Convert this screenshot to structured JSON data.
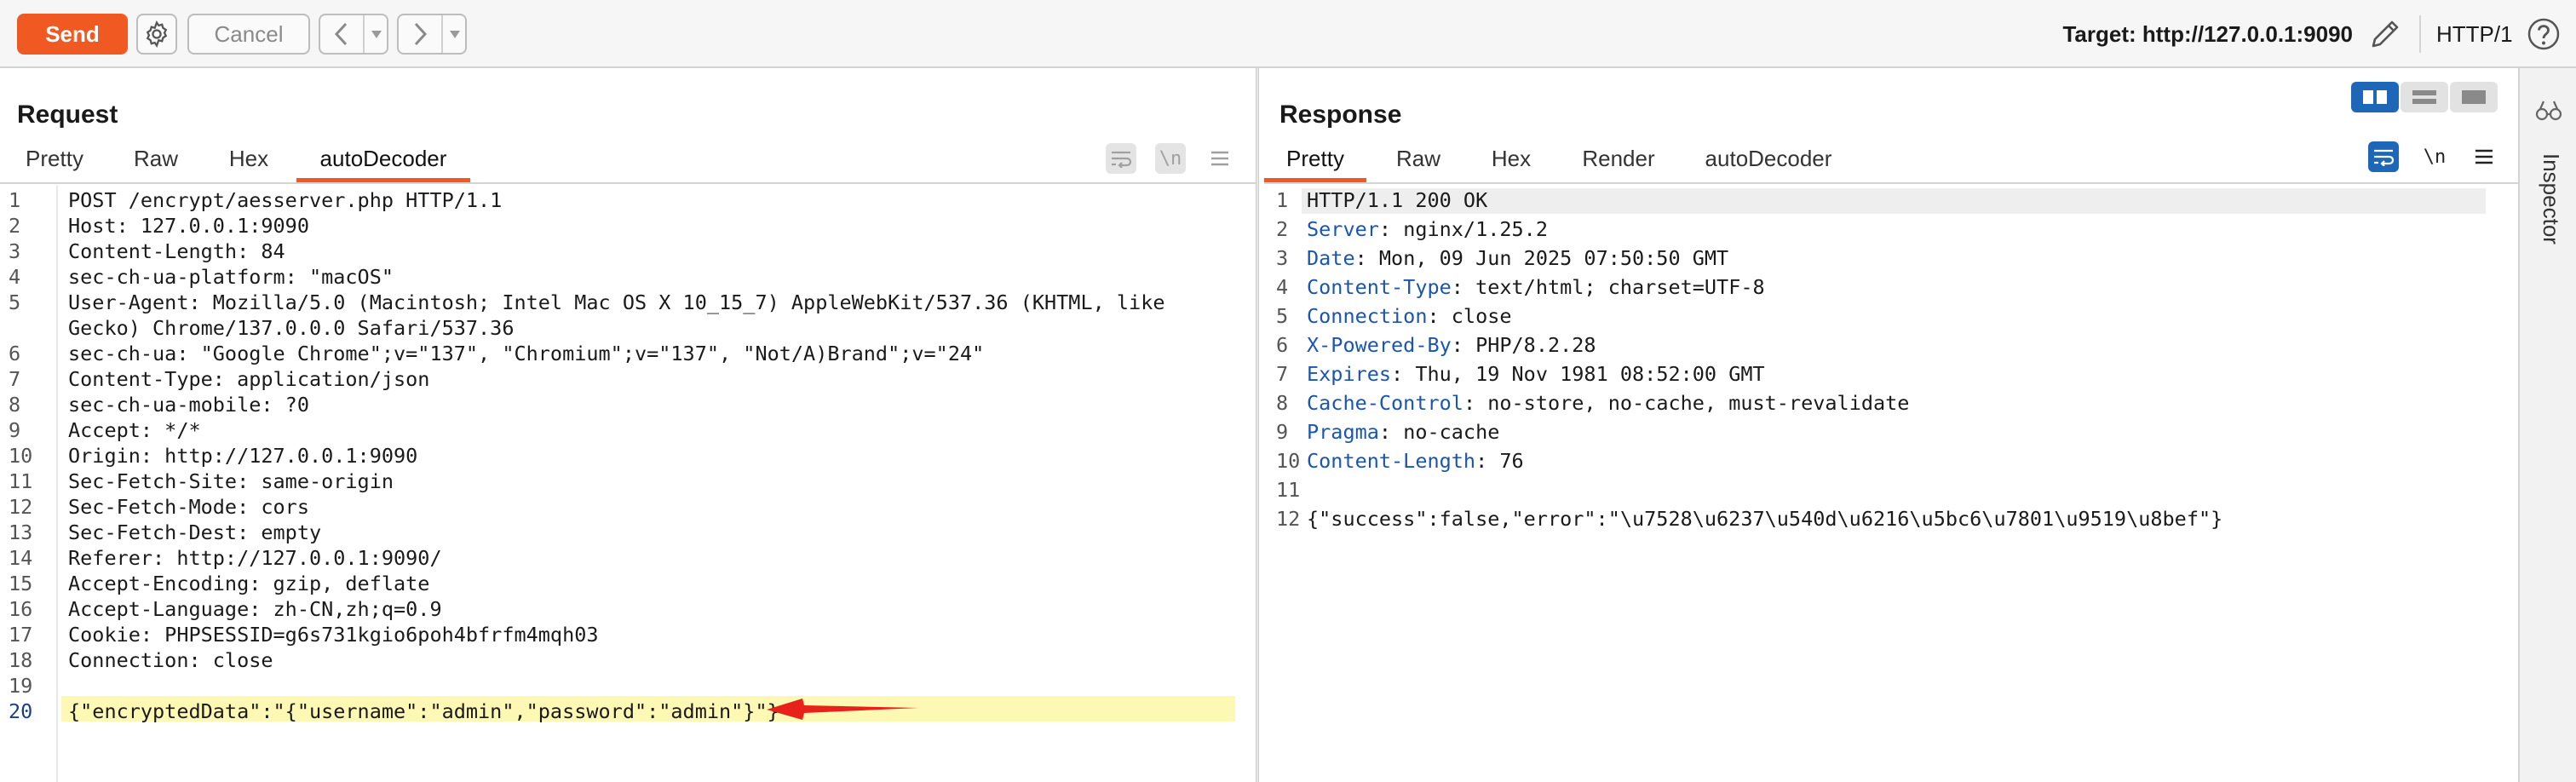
{
  "toolbar": {
    "send_label": "Send",
    "cancel_label": "Cancel",
    "target_label": "Target: http://127.0.0.1:9090",
    "protocol_label": "HTTP/1",
    "accent_color": "#f05a22",
    "icons": [
      "gear-icon",
      "back-arrow-icon",
      "forward-arrow-icon",
      "pencil-icon",
      "help-icon"
    ]
  },
  "request": {
    "title": "Request",
    "tabs": [
      "Pretty",
      "Raw",
      "Hex",
      "autoDecoder"
    ],
    "active_tab": "autoDecoder",
    "wrap_symbol": "\\n",
    "lines": [
      {
        "num": "1",
        "text": "POST /encrypt/aesserver.php HTTP/1.1"
      },
      {
        "num": "2",
        "text": "Host: 127.0.0.1:9090"
      },
      {
        "num": "3",
        "text": "Content-Length: 84"
      },
      {
        "num": "4",
        "text": "sec-ch-ua-platform: \"macOS\""
      },
      {
        "num": "5",
        "text": "User-Agent: Mozilla/5.0 (Macintosh; Intel Mac OS X 10_15_7) AppleWebKit/537.36 (KHTML, like",
        "cont": "Gecko) Chrome/137.0.0.0 Safari/537.36"
      },
      {
        "num": "6",
        "text": "sec-ch-ua: \"Google Chrome\";v=\"137\", \"Chromium\";v=\"137\", \"Not/A)Brand\";v=\"24\""
      },
      {
        "num": "7",
        "text": "Content-Type: application/json"
      },
      {
        "num": "8",
        "text": "sec-ch-ua-mobile: ?0"
      },
      {
        "num": "9",
        "text": "Accept: */*"
      },
      {
        "num": "10",
        "text": "Origin: http://127.0.0.1:9090"
      },
      {
        "num": "11",
        "text": "Sec-Fetch-Site: same-origin"
      },
      {
        "num": "12",
        "text": "Sec-Fetch-Mode: cors"
      },
      {
        "num": "13",
        "text": "Sec-Fetch-Dest: empty"
      },
      {
        "num": "14",
        "text": "Referer: http://127.0.0.1:9090/"
      },
      {
        "num": "15",
        "text": "Accept-Encoding: gzip, deflate"
      },
      {
        "num": "16",
        "text": "Accept-Language: zh-CN,zh;q=0.9"
      },
      {
        "num": "17",
        "text": "Cookie: PHPSESSID=g6s731kgio6poh4bfrfm4mqh03"
      },
      {
        "num": "18",
        "text": "Connection: close"
      },
      {
        "num": "19",
        "text": ""
      },
      {
        "num": "20",
        "text": "{\"encryptedData\":\"{\"username\":\"admin\",\"password\":\"admin\"}\"}",
        "highlight": true
      }
    ],
    "highlight_color": "#fdf8b4",
    "arrow_color": "#e8211b"
  },
  "response": {
    "title": "Response",
    "tabs": [
      "Pretty",
      "Raw",
      "Hex",
      "Render",
      "autoDecoder"
    ],
    "active_tab": "Pretty",
    "wrap_symbol": "\\n",
    "lines": [
      {
        "num": "1",
        "name": "",
        "value": "HTTP/1.1 200 OK"
      },
      {
        "num": "2",
        "name": "Server",
        "value": " nginx/1.25.2"
      },
      {
        "num": "3",
        "name": "Date",
        "value": " Mon, 09 Jun 2025 07:50:50 GMT"
      },
      {
        "num": "4",
        "name": "Content-Type",
        "value": " text/html; charset=UTF-8"
      },
      {
        "num": "5",
        "name": "Connection",
        "value": " close"
      },
      {
        "num": "6",
        "name": "X-Powered-By",
        "value": " PHP/8.2.28"
      },
      {
        "num": "7",
        "name": "Expires",
        "value": " Thu, 19 Nov 1981 08:52:00 GMT"
      },
      {
        "num": "8",
        "name": "Cache-Control",
        "value": " no-store, no-cache, must-revalidate"
      },
      {
        "num": "9",
        "name": "Pragma",
        "value": " no-cache"
      },
      {
        "num": "10",
        "name": "Content-Length",
        "value": " 76"
      },
      {
        "num": "11",
        "name": "",
        "value": ""
      },
      {
        "num": "12",
        "name": "",
        "value": "{\"success\":false,\"error\":\"\\u7528\\u6237\\u540d\\u6216\\u5bc6\\u7801\\u9519\\u8bef\"}"
      }
    ],
    "header_name_color": "#1a55b0"
  },
  "sidebar": {
    "inspector_label": "Inspector"
  }
}
